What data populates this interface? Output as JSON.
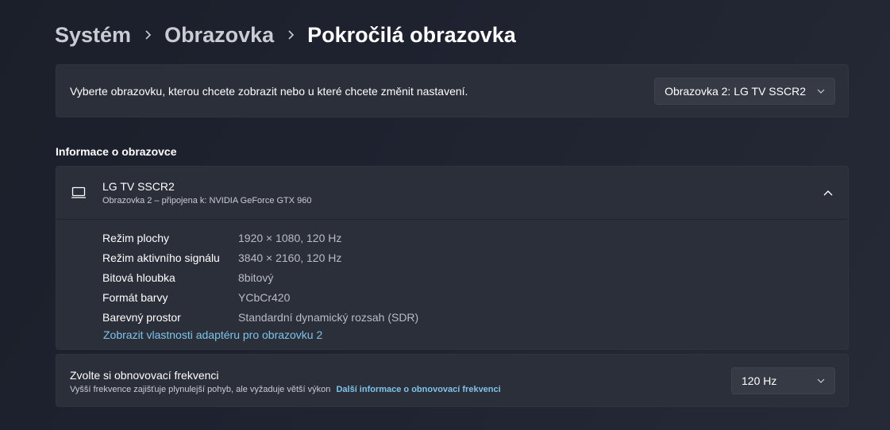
{
  "breadcrumb": {
    "items": [
      "Systém",
      "Obrazovka"
    ],
    "current": "Pokročilá obrazovka"
  },
  "display_select": {
    "label": "Vyberte obrazovku, kterou chcete zobrazit nebo u které chcete změnit nastavení.",
    "selected": "Obrazovka 2: LG TV SSCR2"
  },
  "info_section": {
    "title": "Informace o obrazovce",
    "display_name": "LG TV SSCR2",
    "display_sub": "Obrazovka 2 – připojena k: NVIDIA GeForce GTX 960",
    "properties": [
      {
        "key": "Režim plochy",
        "value": "1920 × 1080, 120 Hz"
      },
      {
        "key": "Režim aktivního signálu",
        "value": "3840 × 2160, 120 Hz"
      },
      {
        "key": "Bitová hloubka",
        "value": "8bitový"
      },
      {
        "key": "Formát barvy",
        "value": "YCbCr420"
      },
      {
        "key": "Barevný prostor",
        "value": "Standardní dynamický rozsah (SDR)"
      }
    ],
    "adapter_link": "Zobrazit vlastnosti adaptéru pro obrazovku 2"
  },
  "refresh": {
    "title": "Zvolte si obnovovací frekvenci",
    "description": "Vyšší frekvence zajišťuje plynulejší pohyb, ale vyžaduje větší výkon",
    "more_link": "Další informace o obnovovací frekvenci",
    "selected": "120 Hz"
  },
  "colors": {
    "accent_link": "#7fc3ea",
    "card_bg": "#2b2f39"
  }
}
